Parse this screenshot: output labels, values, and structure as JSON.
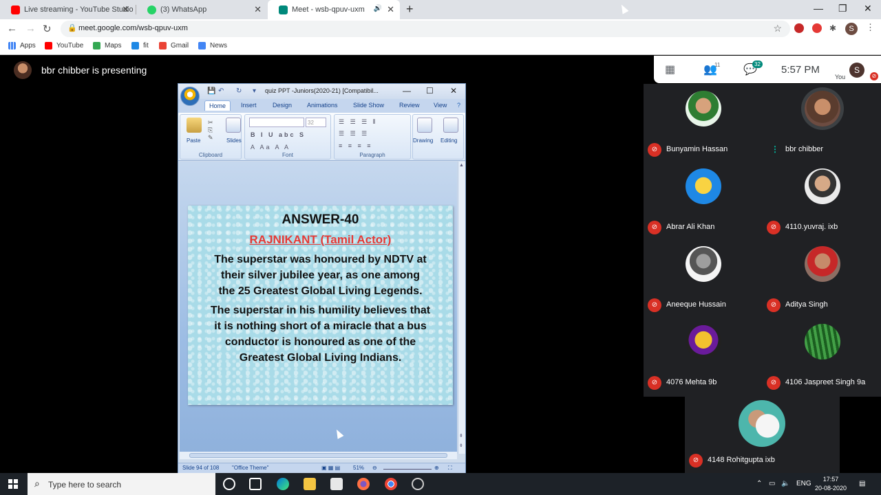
{
  "tabs": [
    {
      "title": "Live streaming - YouTube Studio"
    },
    {
      "title": "(3) WhatsApp"
    },
    {
      "title": "Meet - wsb-qpuv-uxm"
    }
  ],
  "address": {
    "url": "meet.google.com/wsb-qpuv-uxm"
  },
  "profile_initial": "S",
  "bookmarks": [
    "Apps",
    "YouTube",
    "Maps",
    "fit",
    "Gmail",
    "News"
  ],
  "meet": {
    "presenting_text": "bbr chibber is presenting",
    "participant_count": "11",
    "chat_count": "32",
    "time": "5:57 PM",
    "you_label": "You",
    "you_initial": "S",
    "participants": [
      {
        "name": "Bunyamin Hassan",
        "muted": true
      },
      {
        "name": "bbr chibber",
        "muted": false
      },
      {
        "name": "Abrar Ali Khan",
        "muted": true
      },
      {
        "name": "4110.yuvraj. ixb",
        "muted": true
      },
      {
        "name": "Aneeque Hussain",
        "muted": true
      },
      {
        "name": "Aditya Singh",
        "muted": true
      },
      {
        "name": "4076 Mehta 9b",
        "muted": true
      },
      {
        "name": "4106 Jaspreet Singh 9a",
        "muted": true
      },
      {
        "name": "4148 Rohitgupta ixb",
        "muted": true
      }
    ]
  },
  "ppt": {
    "window_title": "quiz PPT -Juniors(2020-21) [Compatibil...",
    "ribbon_tabs": [
      "Home",
      "Insert",
      "Design",
      "Animations",
      "Slide Show",
      "Review",
      "View"
    ],
    "groups": {
      "clipboard": "Clipboard",
      "font": "Font",
      "paragraph": "Paragraph"
    },
    "buttons": {
      "paste": "Paste",
      "slides": "Slides",
      "drawing": "Drawing",
      "editing": "Editing"
    },
    "font_size": "32",
    "status": {
      "slide": "Slide 94 of 108",
      "theme": "\"Office Theme\"",
      "zoom": "51%"
    },
    "slide": {
      "title": "ANSWER-40",
      "subtitle": "RAJNIKANT (Tamil Actor)",
      "para1": [
        "The superstar was honoured by NDTV at",
        "their silver jubilee year, as one among",
        "the 25 Greatest Global Living Legends."
      ],
      "para2": [
        "The superstar in his humility believes that",
        "it is nothing short of a miracle that a bus",
        "conductor is honoured as one of the",
        "Greatest Global Living Indians."
      ]
    }
  },
  "taskbar": {
    "search_placeholder": "Type here to search",
    "lang": "ENG",
    "time": "17:57",
    "date": "20-08-2020"
  },
  "colors": {
    "meet_bg": "#000000",
    "tile_bg": "#202124",
    "mute_red": "#d93025",
    "chat_badge": "#00897b",
    "slide_accent": "#e53935"
  }
}
